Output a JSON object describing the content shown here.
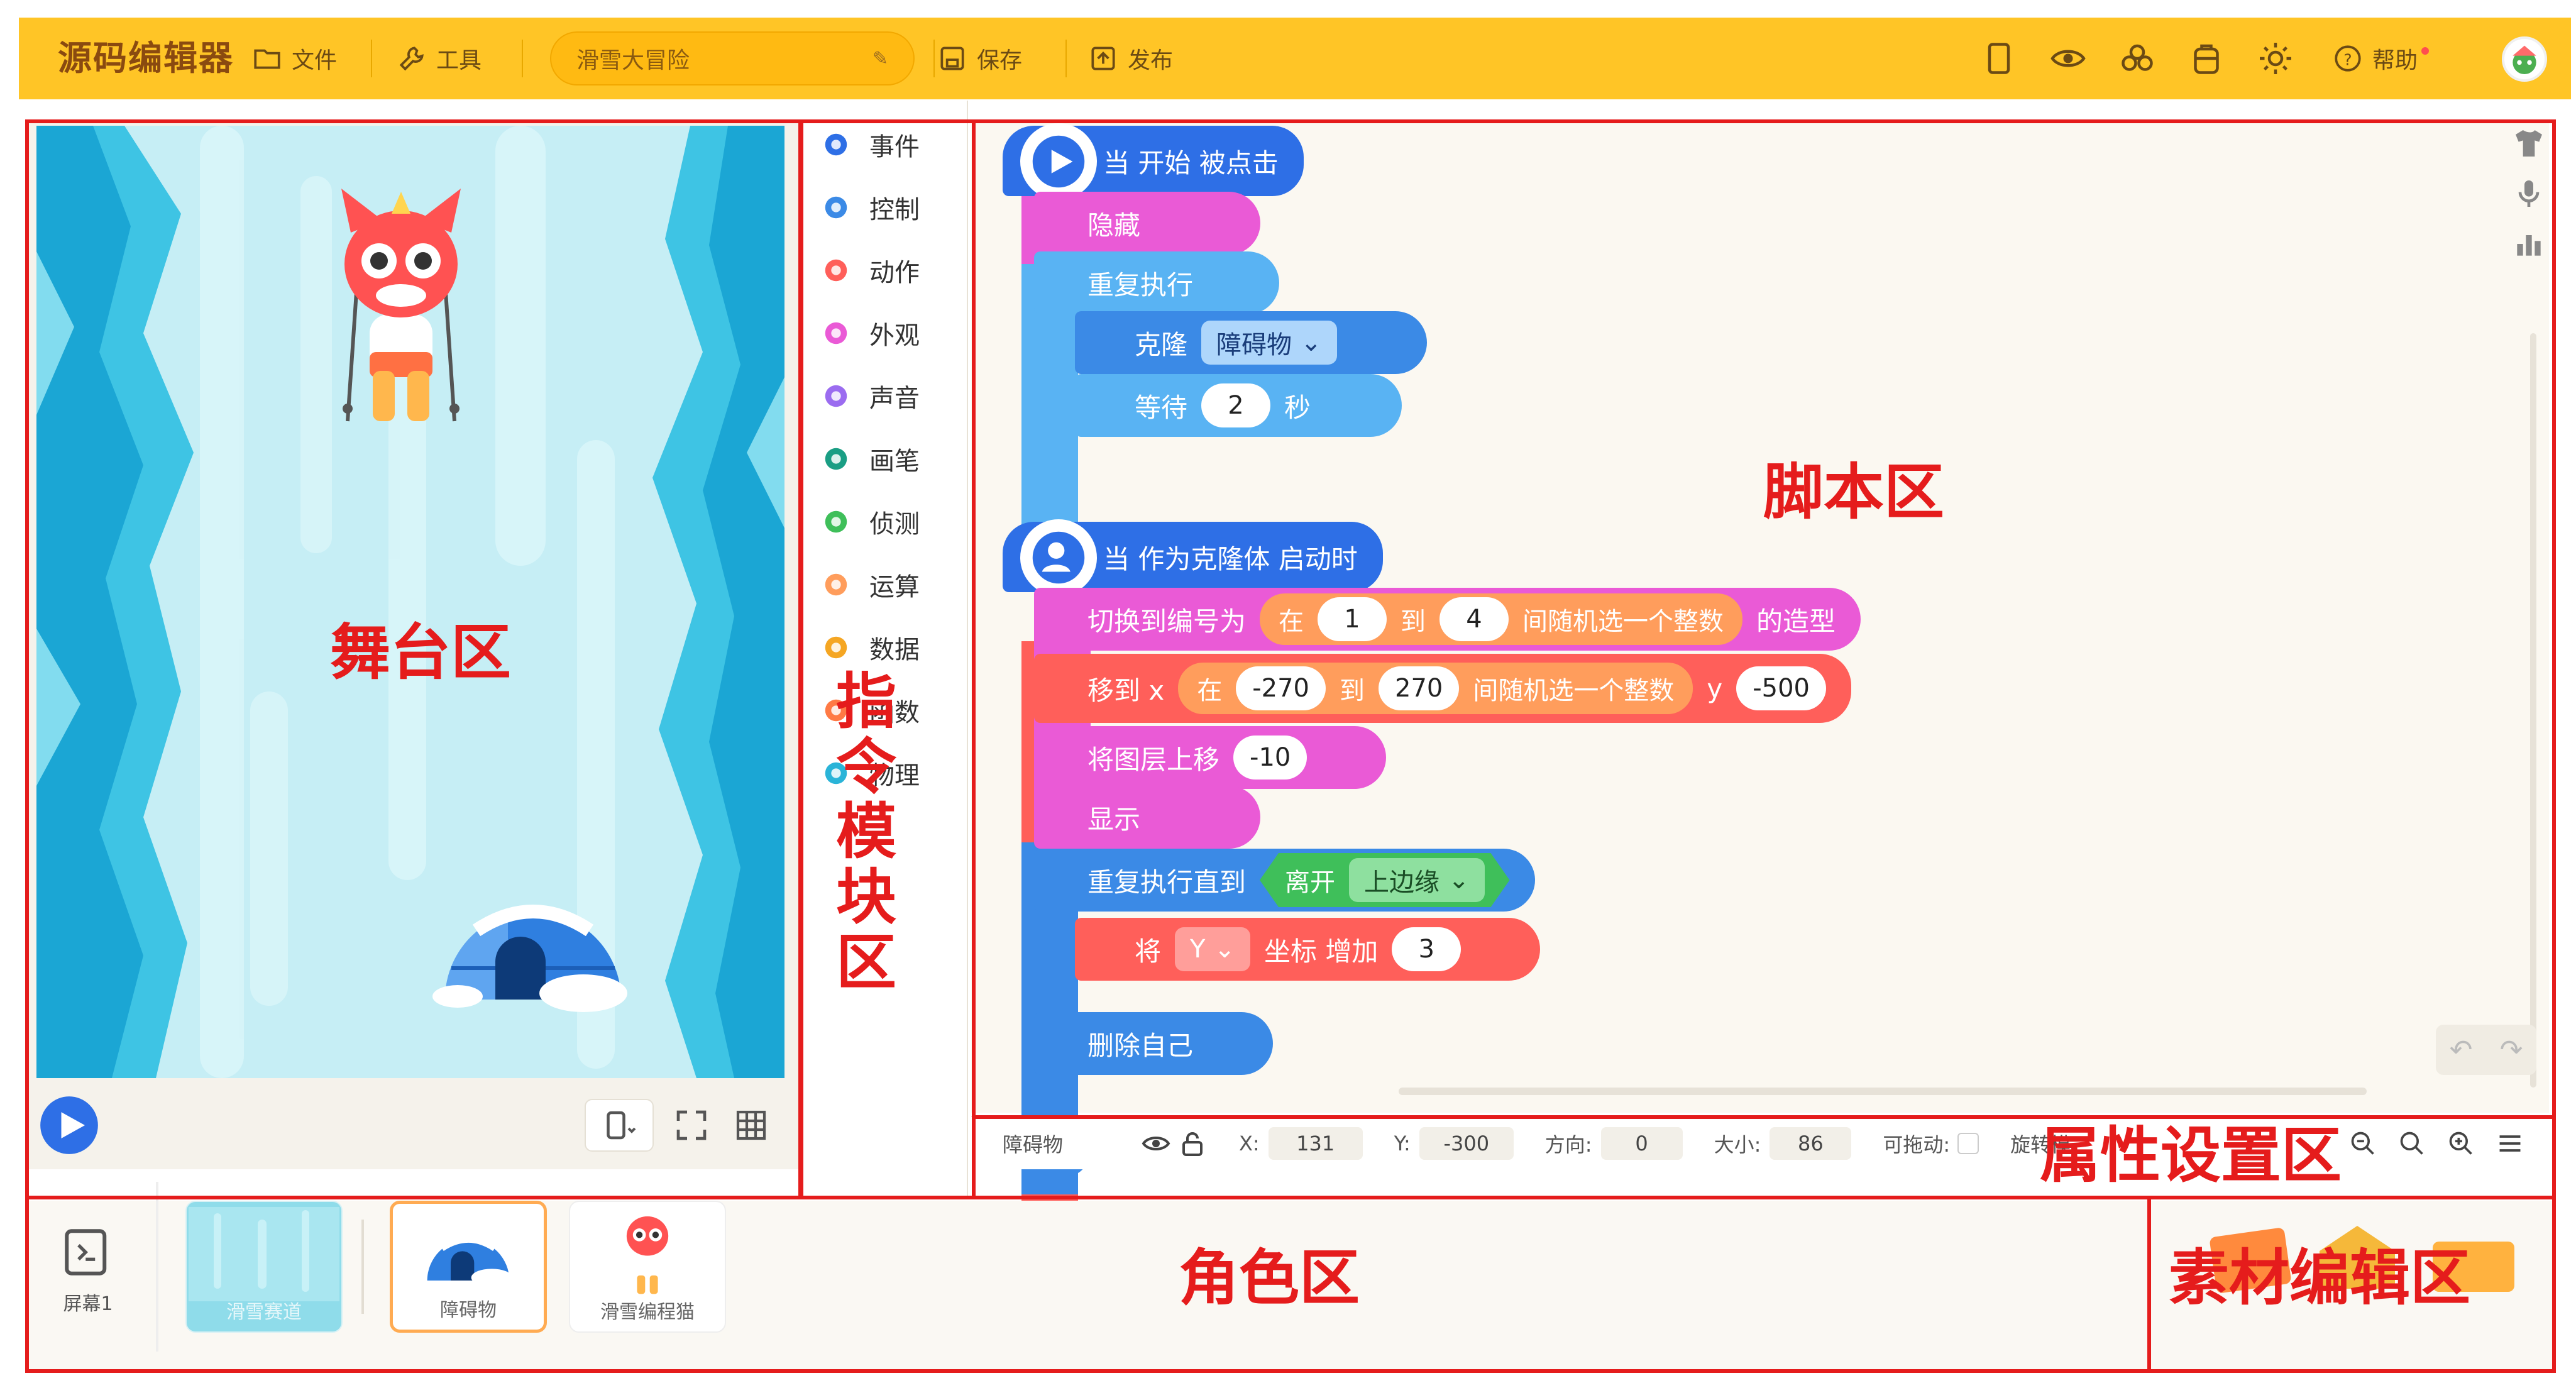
{
  "app": {
    "logo": "源码编辑器",
    "menu": {
      "file": "文件",
      "tools": "工具"
    },
    "project_name": "滑雪大冒险",
    "save": "保存",
    "publish": "发布",
    "help": "帮助"
  },
  "categories": [
    {
      "label": "事件",
      "color": "#2e6fe6"
    },
    {
      "label": "控制",
      "color": "#3b8ae6"
    },
    {
      "label": "动作",
      "color": "#ff5f5a"
    },
    {
      "label": "外观",
      "color": "#ea5ad6"
    },
    {
      "label": "声音",
      "color": "#9b6cf0"
    },
    {
      "label": "画笔",
      "color": "#1a9e84"
    },
    {
      "label": "侦测",
      "color": "#3fbf5a"
    },
    {
      "label": "运算",
      "color": "#ff9d5c"
    },
    {
      "label": "数据",
      "color": "#f5a623"
    },
    {
      "label": "函数",
      "color": "#ff7a45"
    },
    {
      "label": "物理",
      "color": "#2ab4d8"
    }
  ],
  "script1": {
    "hat": "当 开始 被点击",
    "hide": "隐藏",
    "repeat": "重复执行",
    "clone": "克隆",
    "clone_target": "障碍物",
    "wait": "等待",
    "wait_value": "2",
    "wait_unit": "秒"
  },
  "script2": {
    "hat": "当 作为克隆体 启动时",
    "switch_costume": "切换到编号为",
    "rand_in": "在",
    "rand_min": "1",
    "rand_to": "到",
    "rand_max": "4",
    "rand_label": "间随机选一个整数",
    "costume_suffix": "的造型",
    "move_to": "移到 x",
    "x_min": "-270",
    "x_max": "270",
    "y_label": "y",
    "y_value": "-500",
    "layer_up": "将图层上移",
    "layer_value": "-10",
    "show": "显示",
    "repeat_until": "重复执行直到",
    "leave": "离开",
    "edge": "上边缘",
    "change": "将",
    "axis": "Y",
    "coord_inc": "坐标 增加",
    "inc_value": "3",
    "delete_self": "删除自己"
  },
  "properties": {
    "sprite_name": "障碍物",
    "x_label": "X:",
    "x_value": "131",
    "y_label": "Y:",
    "y_value": "-300",
    "dir_label": "方向:",
    "dir_value": "0",
    "size_label": "大小:",
    "size_value": "86",
    "drag_label": "可拖动:",
    "rotate_label": "旋转模"
  },
  "sprites": {
    "screen_label": "屏幕1",
    "items": [
      {
        "label": "滑雪赛道"
      },
      {
        "label": "障碍物"
      },
      {
        "label": "滑雪编程猫"
      }
    ]
  },
  "annotations": {
    "stage": "舞台区",
    "blocks": [
      "指",
      "令",
      "模",
      "块",
      "区"
    ],
    "script": "脚本区",
    "props": "属性设置区",
    "sprites": "角色区",
    "assets": "素材编辑区"
  }
}
